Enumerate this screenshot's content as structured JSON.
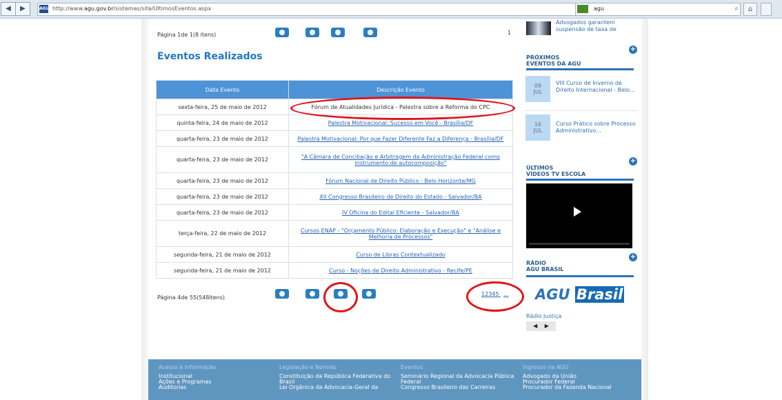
{
  "browser": {
    "url_prefix": "http://www.",
    "url_domain": "agu.gov.br",
    "url_path": "/sistemas/site/UltimosEventos.aspx",
    "search_value": "agu"
  },
  "pagination": {
    "top_label": "Página 1de 1(8 itens)",
    "top_number": "1",
    "bottom_label": "Página 4de 55(548itens)",
    "page_links": [
      "1",
      "2",
      "3",
      "4",
      "5",
      "..."
    ]
  },
  "content": {
    "section_title": "Eventos Realizados",
    "table_headers": [
      "Data Evento",
      "Descrição Evento"
    ],
    "rows": [
      {
        "date": "sexta-feira, 25 de maio de 2012",
        "event": "Fórum de Atualidades Jurídica - Palestra sobre a Reforma do CPC",
        "link": false
      },
      {
        "date": "quinta-feira, 24 de maio de 2012",
        "event": "Palestra Motivacional: Sucesso em Você - Brasília/DF",
        "link": true
      },
      {
        "date": "quarta-feira, 23 de maio de 2012",
        "event": "Palestra Motivacional: Por que Fazer Diferente Faz a Diferença - Brasília/DF",
        "link": true
      },
      {
        "date": "quarta-feira, 23 de maio de 2012",
        "event": "\"A Câmara de Conciliação e Arbitragem da Administração Federal como instrumento de autocomposição\"",
        "link": true
      },
      {
        "date": "quarta-feira, 23 de maio de 2012",
        "event": "Fórum Nacional de Direito Público - Belo Horizonte/MG",
        "link": true
      },
      {
        "date": "quarta-feira, 23 de maio de 2012",
        "event": "XII Congresso Brasileiro de Direito do Estado - Salvador/BA",
        "link": true
      },
      {
        "date": "quarta-feira, 23 de maio de 2012",
        "event": "IV Oficina do Edital Eficiente - Salvador/BA",
        "link": true
      },
      {
        "date": "terça-feira, 22 de maio de 2012",
        "event": "Cursos ENAP - \"Orçamento Público: Elaboração e Execução\" e \"Análise e Melhoria de Processos\"",
        "link": true
      },
      {
        "date": "segunda-feira, 21 de maio de 2012",
        "event": "Curso de Libras Contextualizado",
        "link": true
      },
      {
        "date": "segunda-feira, 21 de maio de 2012",
        "event": "Curso - Noções de Direito Administrativo - Recife/PE",
        "link": true
      }
    ]
  },
  "sidebar": {
    "news_text_1": "Advogados garantem",
    "news_text_2": "suspensão de taxa de",
    "upcoming_heading": "PRÓXIMOS",
    "upcoming_subheading": "EVENTOS DA AGU",
    "upcoming": [
      {
        "day": "09",
        "month": "JUL",
        "text": "VIII Curso de Inverno de Direito Internacional - Belo..."
      },
      {
        "day": "16",
        "month": "JUL",
        "text": "Curso Prático sobre Processo Administrativo..."
      }
    ],
    "videos_heading": "ÚLTIMOS",
    "videos_subheading": "VÍDEOS TV ESCOLA",
    "radio_heading": "RÁDIO",
    "radio_subheading": "AGU BRASIL",
    "logo_prefix": "AGU",
    "logo_suffix": "Brasil",
    "radio_link": "Rádio Justiça"
  },
  "footer": {
    "columns": [
      {
        "heading": "Acesso à Informação",
        "items": [
          "Institucional",
          "Ações e Programas",
          "Auditorias"
        ]
      },
      {
        "heading": "Legislação e Normas",
        "items": [
          "Constituição da República Federativa do",
          "Brasil",
          "Lei Orgânica da Advocacia-Geral da"
        ]
      },
      {
        "heading": "Eventos",
        "items": [
          "Seminário Regional da Advocacia Pública",
          "Federal",
          "Congresso Brasileiro das Carreiras"
        ]
      },
      {
        "heading": "Ingresso na AGU",
        "items": [
          "Advogado da União",
          "Procurador Federal",
          "Procurador da Fazenda Nacional"
        ]
      }
    ]
  },
  "icons": [
    "back-icon",
    "forward-icon",
    "star-icon",
    "refresh-icon",
    "search-icon",
    "home-icon",
    "first-page-icon",
    "previous-page-icon",
    "next-page-icon",
    "last-page-icon",
    "plus-icon",
    "play-icon"
  ]
}
